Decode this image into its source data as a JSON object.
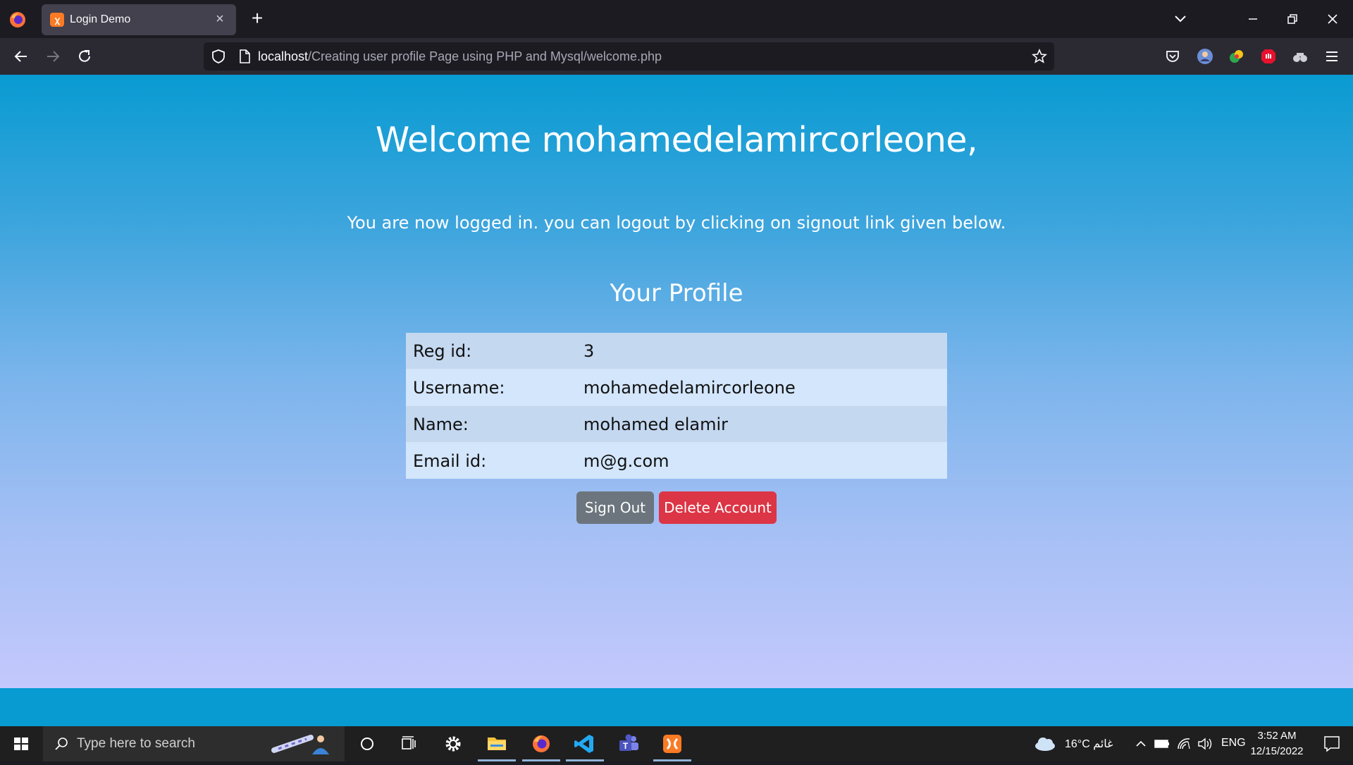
{
  "browser": {
    "tab_title": "Login Demo",
    "url_host": "localhost",
    "url_path": "/Creating user profile Page using PHP and Mysql/welcome.php"
  },
  "page": {
    "welcome": "Welcome mohamedelamircorleone,",
    "subtitle": "You are now logged in. you can logout by clicking on signout link given below.",
    "profile_heading": "Your Profile",
    "profile_rows": [
      {
        "label": "Reg id:",
        "value": "3"
      },
      {
        "label": "Username:",
        "value": "mohamedelamircorleone"
      },
      {
        "label": "Name:",
        "value": "mohamed elamir"
      },
      {
        "label": "Email id:",
        "value": "m@g.com"
      }
    ],
    "signout_label": "Sign Out",
    "delete_label": "Delete Account"
  },
  "taskbar": {
    "search_placeholder": "Type here to search",
    "weather": "16°C  غائم",
    "language": "ENG",
    "time": "3:52 AM",
    "date": "12/15/2022"
  },
  "colors": {
    "gradient_top": "#089bd2",
    "gradient_bottom": "#c4c8fc",
    "signout_button": "#6c757d",
    "delete_button": "#dc3545"
  }
}
